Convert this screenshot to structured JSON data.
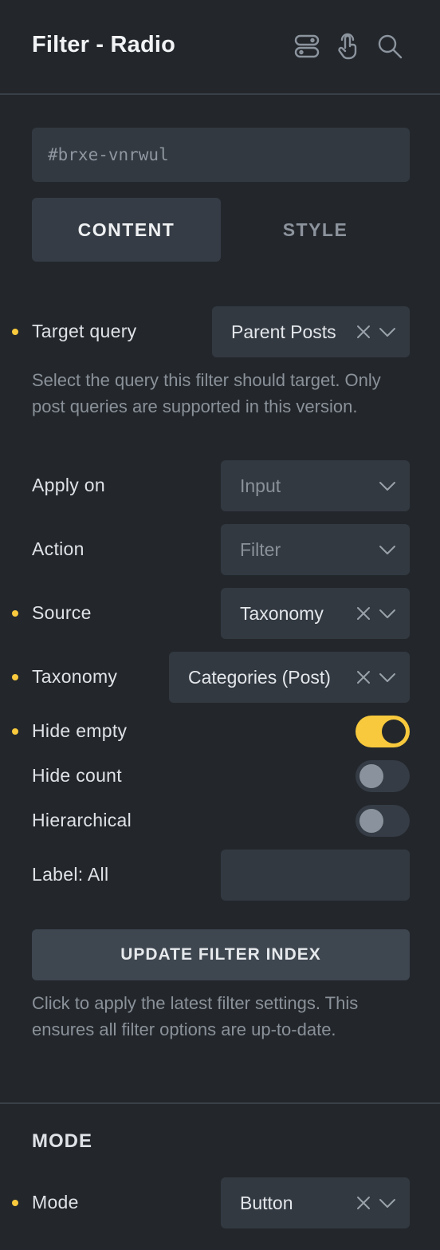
{
  "header": {
    "title": "Filter - Radio",
    "icons": [
      "toggle-switch-icon",
      "pointer-icon",
      "search-icon"
    ]
  },
  "element_id": {
    "placeholder": "#brxe-vnrwul"
  },
  "tabs": [
    {
      "label": "CONTENT",
      "active": true
    },
    {
      "label": "STYLE",
      "active": false
    }
  ],
  "controls": {
    "target_query": {
      "label": "Target query",
      "value": "Parent Posts",
      "modified": true
    },
    "target_query_desc": "Select the query this filter should target. Only post queries are supported in this version.",
    "apply_on": {
      "label": "Apply on",
      "placeholder": "Input"
    },
    "action": {
      "label": "Action",
      "placeholder": "Filter"
    },
    "source": {
      "label": "Source",
      "value": "Taxonomy",
      "modified": true
    },
    "taxonomy": {
      "label": "Taxonomy",
      "value": "Categories (Post)",
      "modified": true
    },
    "hide_empty": {
      "label": "Hide empty",
      "on": true,
      "modified": true
    },
    "hide_count": {
      "label": "Hide count",
      "on": false
    },
    "hierarchical": {
      "label": "Hierarchical",
      "on": false
    },
    "label_all": {
      "label": "Label: All",
      "value": ""
    },
    "update_button": "UPDATE FILTER INDEX",
    "update_desc": "Click to apply the latest filter settings. This ensures all filter options are up-to-date."
  },
  "mode_section": {
    "title": "MODE",
    "mode": {
      "label": "Mode",
      "value": "Button",
      "modified": true
    }
  },
  "colors": {
    "background": "#23272c",
    "field": "#323941",
    "accent": "#f8c93d"
  }
}
